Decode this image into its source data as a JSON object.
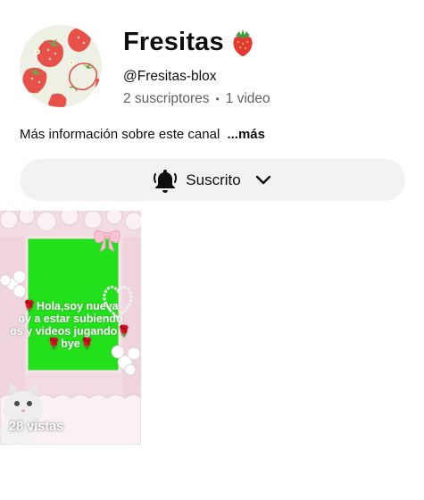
{
  "channel": {
    "name": "Fresitas",
    "name_emoji": "strawberry-emoji",
    "handle": "@Fresitas-blox",
    "subscribers": "2 suscriptores",
    "separator": "•",
    "videos": "1 video",
    "about": "Más información sobre este canal",
    "about_more": "...más"
  },
  "subscribe_button": {
    "label": "Suscrito",
    "icon": "bell-icon",
    "chevron": "chevron-down-icon"
  },
  "shorts": [
    {
      "views": "28 vistas",
      "overlay_lines": [
        "🌹Hola,soy nueva",
        "oy a estar subiendo",
        "os y videos jugando🌹",
        "🌹bye🌹"
      ]
    }
  ],
  "colors": {
    "secondary_text": "#606060",
    "button_bg": "#f2f2f2",
    "screen_green": "#22e01a",
    "frame_pink": "#f3dbe4",
    "strawberry_red": "#e8403c"
  }
}
